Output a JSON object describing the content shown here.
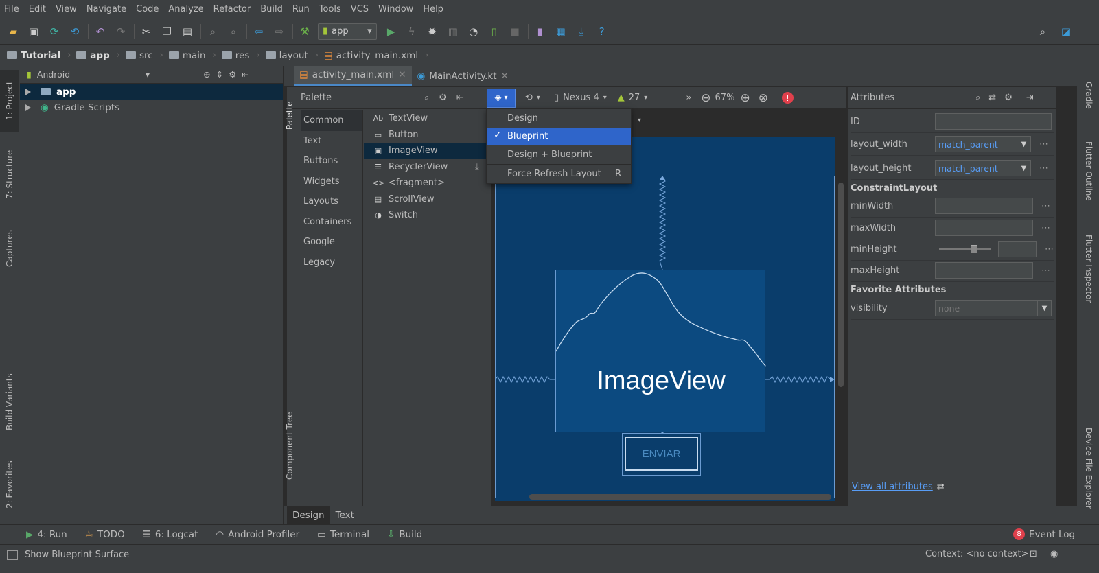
{
  "menu": [
    "File",
    "Edit",
    "View",
    "Navigate",
    "Code",
    "Analyze",
    "Refactor",
    "Build",
    "Run",
    "Tools",
    "VCS",
    "Window",
    "Help"
  ],
  "toolbar": {
    "run_config": "app"
  },
  "breadcrumb": [
    "Tutorial",
    "app",
    "src",
    "main",
    "res",
    "layout",
    "activity_main.xml"
  ],
  "left_strip": {
    "project": "1: Project",
    "structure": "7: Structure",
    "captures": "Captures",
    "build_variants": "Build Variants",
    "favorites": "2: Favorites"
  },
  "right_strip": {
    "gradle": "Gradle",
    "flutter_outline": "Flutter Outline",
    "flutter_inspector": "Flutter Inspector",
    "device_explorer": "Device File Explorer"
  },
  "project": {
    "view_mode": "Android",
    "items": [
      "app",
      "Gradle Scripts"
    ]
  },
  "editor_tabs": [
    "activity_main.xml",
    "MainActivity.kt"
  ],
  "palette": {
    "title": "Palette",
    "side_tab": "Palette",
    "component_tree_tab": "Component Tree",
    "categories": [
      "Common",
      "Text",
      "Buttons",
      "Widgets",
      "Layouts",
      "Containers",
      "Google",
      "Legacy"
    ],
    "items": [
      {
        "icon": "Ab",
        "label": "TextView"
      },
      {
        "icon": "▭",
        "label": "Button"
      },
      {
        "icon": "▣",
        "label": "ImageView"
      },
      {
        "icon": "☰",
        "label": "RecyclerView"
      },
      {
        "icon": "<>",
        "label": "<fragment>"
      },
      {
        "icon": "▤",
        "label": "ScrollView"
      },
      {
        "icon": "◑",
        "label": "Switch"
      }
    ]
  },
  "design_bar": {
    "device": "Nexus 4",
    "api": "27",
    "zoom": "67%"
  },
  "dropdown": {
    "items": [
      "Design",
      "Blueprint",
      "Design + Blueprint",
      "Force Refresh Layout"
    ],
    "selected": "Blueprint",
    "shortcut": "R"
  },
  "canvas": {
    "imageview_label": "ImageView",
    "button_label": "ENVIAR"
  },
  "attributes": {
    "title": "Attributes",
    "id_label": "ID",
    "layout_width_label": "layout_width",
    "layout_width_value": "match_parent",
    "layout_height_label": "layout_height",
    "layout_height_value": "match_parent",
    "constraint_section": "ConstraintLayout",
    "minwidth": "minWidth",
    "maxwidth": "maxWidth",
    "minheight": "minHeight",
    "maxheight": "maxHeight",
    "favorites_section": "Favorite Attributes",
    "visibility_label": "visibility",
    "visibility_value": "none",
    "view_all": "View all attributes"
  },
  "bottom_tabs": [
    "Design",
    "Text"
  ],
  "tool_windows": [
    {
      "label": "4: Run",
      "icon": "run-icon"
    },
    {
      "label": "TODO",
      "icon": "todo-icon"
    },
    {
      "label": "6: Logcat",
      "icon": "logcat-icon"
    },
    {
      "label": "Android Profiler",
      "icon": "profiler-icon"
    },
    {
      "label": "Terminal",
      "icon": "terminal-icon"
    },
    {
      "label": "Build",
      "icon": "build-icon"
    }
  ],
  "event_log": {
    "count": "8",
    "label": "Event Log"
  },
  "status": {
    "message": "Show Blueprint Surface",
    "context": "Context: <no context>"
  },
  "colors": {
    "accent": "#2f65ca",
    "blueprint": "#0a3d6b",
    "error": "#e0404c"
  }
}
